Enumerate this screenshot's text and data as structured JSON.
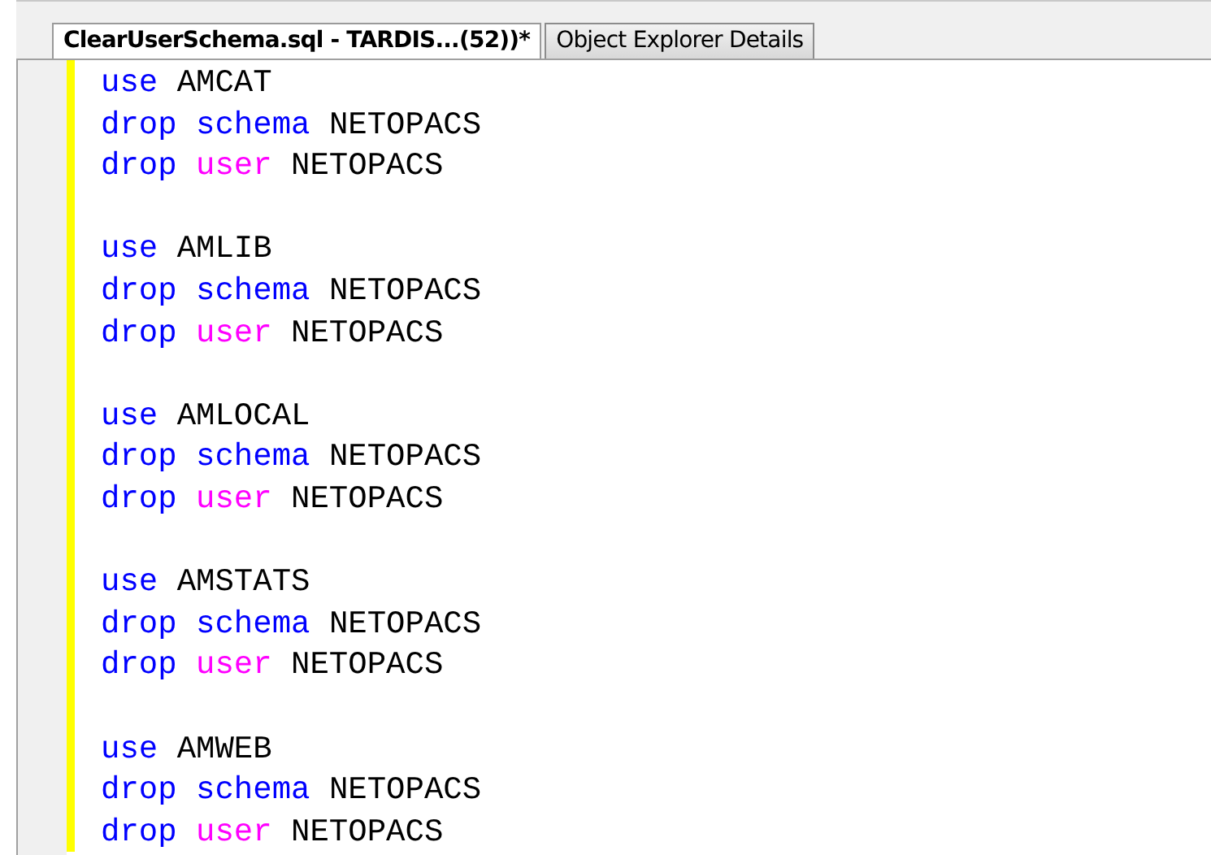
{
  "tabs": [
    {
      "label": "ClearUserSchema.sql - TARDIS...(52))*",
      "selected": true
    },
    {
      "label": "Object Explorer Details",
      "selected": false
    }
  ],
  "editor": {
    "blocks": [
      {
        "lines": [
          {
            "tokens": [
              {
                "kind": "keyword",
                "text": "use"
              },
              {
                "kind": "plain",
                "text": "AMCAT"
              }
            ]
          },
          {
            "tokens": [
              {
                "kind": "keyword",
                "text": "drop"
              },
              {
                "kind": "keyword",
                "text": "schema"
              },
              {
                "kind": "plain",
                "text": "NETOPACS"
              }
            ]
          },
          {
            "tokens": [
              {
                "kind": "keyword",
                "text": "drop"
              },
              {
                "kind": "function",
                "text": "user"
              },
              {
                "kind": "plain",
                "text": "NETOPACS"
              }
            ]
          }
        ]
      },
      {
        "lines": [
          {
            "tokens": [
              {
                "kind": "keyword",
                "text": "use"
              },
              {
                "kind": "plain",
                "text": "AMLIB"
              }
            ]
          },
          {
            "tokens": [
              {
                "kind": "keyword",
                "text": "drop"
              },
              {
                "kind": "keyword",
                "text": "schema"
              },
              {
                "kind": "plain",
                "text": "NETOPACS"
              }
            ]
          },
          {
            "tokens": [
              {
                "kind": "keyword",
                "text": "drop"
              },
              {
                "kind": "function",
                "text": "user"
              },
              {
                "kind": "plain",
                "text": "NETOPACS"
              }
            ]
          }
        ]
      },
      {
        "lines": [
          {
            "tokens": [
              {
                "kind": "keyword",
                "text": "use"
              },
              {
                "kind": "plain",
                "text": "AMLOCAL"
              }
            ]
          },
          {
            "tokens": [
              {
                "kind": "keyword",
                "text": "drop"
              },
              {
                "kind": "keyword",
                "text": "schema"
              },
              {
                "kind": "plain",
                "text": "NETOPACS"
              }
            ]
          },
          {
            "tokens": [
              {
                "kind": "keyword",
                "text": "drop"
              },
              {
                "kind": "function",
                "text": "user"
              },
              {
                "kind": "plain",
                "text": "NETOPACS"
              }
            ]
          }
        ]
      },
      {
        "lines": [
          {
            "tokens": [
              {
                "kind": "keyword",
                "text": "use"
              },
              {
                "kind": "plain",
                "text": "AMSTATS"
              }
            ]
          },
          {
            "tokens": [
              {
                "kind": "keyword",
                "text": "drop"
              },
              {
                "kind": "keyword",
                "text": "schema"
              },
              {
                "kind": "plain",
                "text": "NETOPACS"
              }
            ]
          },
          {
            "tokens": [
              {
                "kind": "keyword",
                "text": "drop"
              },
              {
                "kind": "function",
                "text": "user"
              },
              {
                "kind": "plain",
                "text": "NETOPACS"
              }
            ]
          }
        ]
      },
      {
        "lines": [
          {
            "tokens": [
              {
                "kind": "keyword",
                "text": "use"
              },
              {
                "kind": "plain",
                "text": "AMWEB"
              }
            ]
          },
          {
            "tokens": [
              {
                "kind": "keyword",
                "text": "drop"
              },
              {
                "kind": "keyword",
                "text": "schema"
              },
              {
                "kind": "plain",
                "text": "NETOPACS"
              }
            ]
          },
          {
            "tokens": [
              {
                "kind": "keyword",
                "text": "drop"
              },
              {
                "kind": "function",
                "text": "user"
              },
              {
                "kind": "plain",
                "text": "NETOPACS"
              }
            ]
          }
        ]
      }
    ]
  }
}
